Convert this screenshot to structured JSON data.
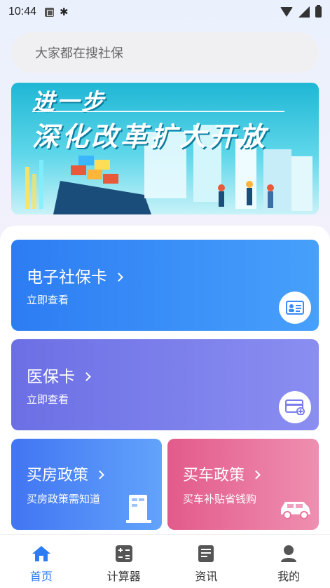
{
  "status_bar": {
    "time": "10:44"
  },
  "search": {
    "placeholder": "大家都在搜社保"
  },
  "banner": {
    "line1": "进一步",
    "line2": "深化改革扩大开放"
  },
  "cards": {
    "social": {
      "title": "电子社保卡",
      "subtitle": "立即查看"
    },
    "medical": {
      "title": "医保卡",
      "subtitle": "立即查看"
    },
    "house": {
      "title": "买房政策",
      "subtitle": "买房政策需知道"
    },
    "car": {
      "title": "买车政策",
      "subtitle": "买车补贴省钱购"
    }
  },
  "nav": {
    "items": [
      {
        "label": "首页",
        "icon": "home-icon",
        "active": true
      },
      {
        "label": "计算器",
        "icon": "calculator-icon",
        "active": false
      },
      {
        "label": "资讯",
        "icon": "news-icon",
        "active": false
      },
      {
        "label": "我的",
        "icon": "user-icon",
        "active": false
      }
    ]
  },
  "colors": {
    "accent": "#2d7cf3",
    "card_social": "#3b8cf7",
    "card_medical": "#7b7eea",
    "card_house": "#4f8cf6",
    "card_car": "#e8739d"
  }
}
